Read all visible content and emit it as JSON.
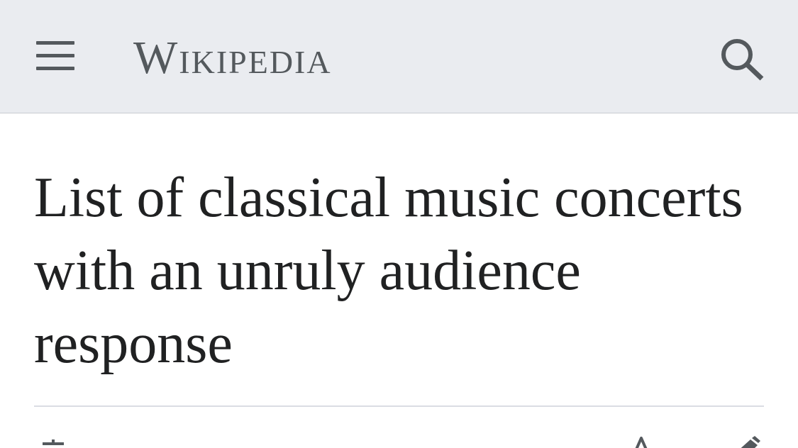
{
  "header": {
    "menu_icon": "hamburger-menu-icon",
    "wordmark": "Wikipedia",
    "search_icon": "magnifying-glass-icon",
    "background_color": "#eaecf0",
    "icon_color": "#54595d"
  },
  "article": {
    "title": "List of classical music concerts with an unruly audience response",
    "title_color": "#202122"
  },
  "toolbar": {
    "language_icon": "language-icon",
    "watch_icon": "star-icon",
    "edit_icon": "pencil-icon"
  }
}
